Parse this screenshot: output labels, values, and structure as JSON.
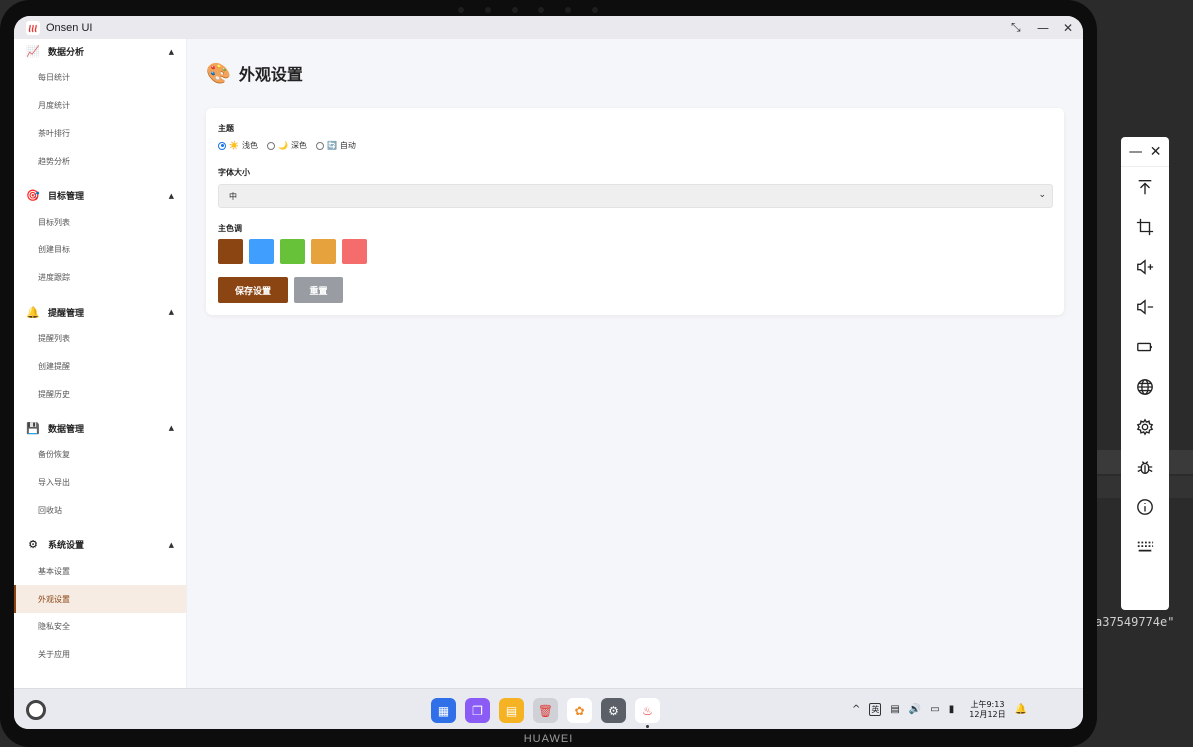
{
  "background": {
    "code_text": "a37549774e\""
  },
  "device": {
    "brand": "HUAWEI"
  },
  "window": {
    "title": "Onsen UI",
    "controls": {
      "restore": "⤡",
      "minimize": "—",
      "close": "✕"
    }
  },
  "sidebar": {
    "groups": [
      {
        "label": "数据分析",
        "icon": "chart-icon",
        "glyph": "📈",
        "items": [
          "每日统计",
          "月度统计",
          "茶叶排行",
          "趋势分析"
        ]
      },
      {
        "label": "目标管理",
        "icon": "target-icon",
        "glyph": "🎯",
        "items": [
          "目标列表",
          "创建目标",
          "进度跟踪"
        ]
      },
      {
        "label": "提醒管理",
        "icon": "bell-icon",
        "glyph": "🔔",
        "items": [
          "提醒列表",
          "创建提醒",
          "提醒历史"
        ]
      },
      {
        "label": "数据管理",
        "icon": "floppy-icon",
        "glyph": "💾",
        "items": [
          "备份恢复",
          "导入导出",
          "回收站"
        ]
      },
      {
        "label": "系统设置",
        "icon": "gear-icon",
        "glyph": "⚙",
        "items": [
          "基本设置",
          "外观设置",
          "隐私安全",
          "关于应用"
        ]
      }
    ],
    "arrow": "▲",
    "active_item": "外观设置"
  },
  "main": {
    "page_icon": "🎨",
    "page_title": "外观设置",
    "theme": {
      "label": "主题",
      "options": [
        {
          "emoji": "☀️",
          "label": "浅色",
          "checked": true
        },
        {
          "emoji": "🌙",
          "label": "深色",
          "checked": false
        },
        {
          "emoji": "🔄",
          "label": "自动",
          "checked": false
        }
      ]
    },
    "font_size": {
      "label": "字体大小",
      "value": "中",
      "chevron": "⌄"
    },
    "primary_color": {
      "label": "主色调",
      "colors": [
        "#8b4513",
        "#409eff",
        "#67c23a",
        "#e6a23c",
        "#f56c6c"
      ]
    },
    "buttons": {
      "save": "保存设置",
      "reset": "重置"
    }
  },
  "taskbar": {
    "dock": [
      {
        "name": "app-grid-icon",
        "color": "#2f6fe8",
        "glyph": "▦"
      },
      {
        "name": "multitask-icon",
        "color": "#8a5cf5",
        "glyph": "❐"
      },
      {
        "name": "notes-icon",
        "color": "#f5b324",
        "glyph": "▤"
      },
      {
        "name": "trash-icon",
        "color": "#cfd1d6",
        "glyph": "🗑"
      },
      {
        "name": "gallery-icon",
        "color": "#ffffff",
        "glyph": "✿"
      },
      {
        "name": "settings-icon",
        "color": "#5a5f68",
        "glyph": "⚙"
      },
      {
        "name": "onsen-app-icon",
        "color": "#ffffff",
        "glyph": "♨"
      }
    ],
    "tray": {
      "chevron": "^",
      "ime": "英",
      "clock_time": "上午9:13",
      "clock_date": "12月12日"
    }
  },
  "toolpanel": {
    "minimize": "—",
    "close": "✕",
    "tools": [
      "top-icon",
      "crop-icon",
      "volume-up-icon",
      "volume-down-icon",
      "battery-icon",
      "globe-icon",
      "gear-icon",
      "bug-icon",
      "info-icon",
      "keyboard-icon"
    ]
  }
}
